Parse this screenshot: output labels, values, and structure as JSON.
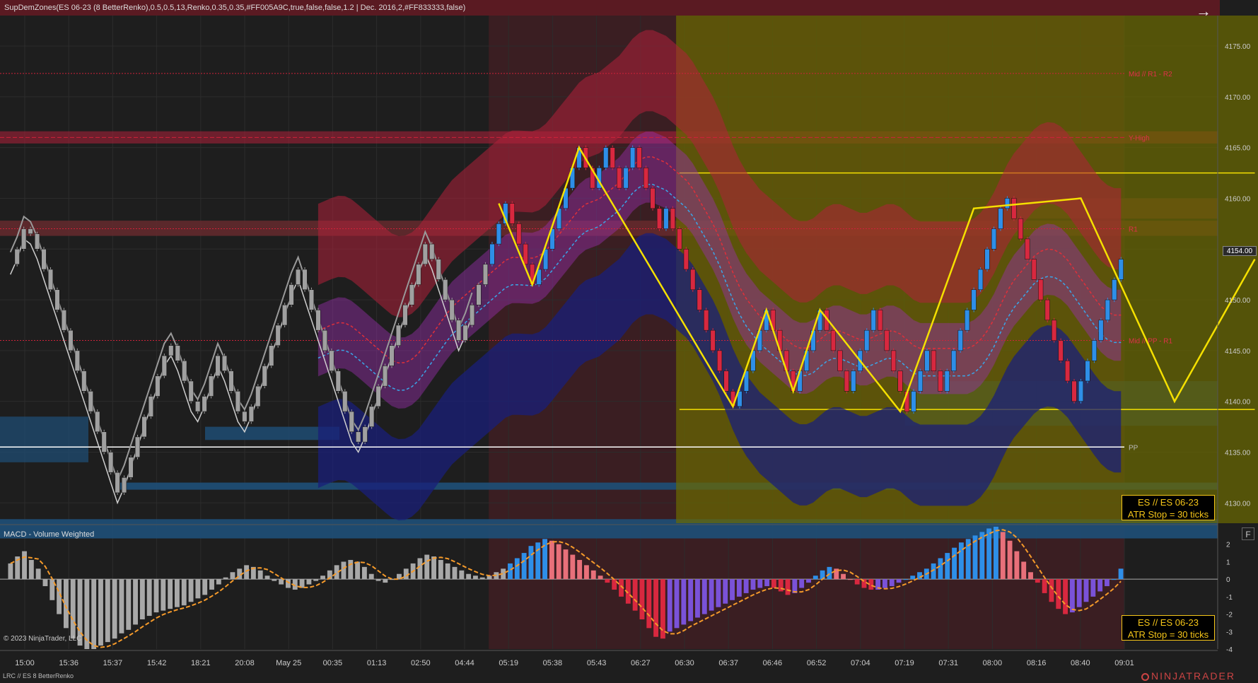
{
  "window": {
    "title": "SupDemZones(ES 06-23 (8 BetterRenko),0.5,0.5,13,Renko,0.35,0.35,#FF005A9C,true,false,false,1.2 | Dec. 2016,2,#FF833333,false)",
    "arrow_icon": "arrow-right-icon",
    "f_button_label": "F",
    "macd_title": "MACD - Volume Weighted",
    "copyright": "© 2023 NinjaTrader, LLC",
    "instrument_label": "LRC // ES  8 BetterRenko",
    "brand": "NINJATRADER",
    "current_price": "4154.00"
  },
  "info_boxes": [
    {
      "line1": "ES // ES 06-23",
      "line2": "ATR Stop = 30 ticks"
    },
    {
      "line1": "ES // ES 06-23",
      "line2": "ATR Stop = 30 ticks"
    }
  ],
  "colors": {
    "background": "#1e1e1e",
    "up_candle": "#2e8fe8",
    "down_candle": "#d8283f",
    "neutral_candle": "#a0a0a0",
    "red_band": "#b0203a",
    "blue_band": "#1a1f7a",
    "magenta_band": "#9a2fae",
    "yellow_box": "#6b6a00",
    "session_shade": "#3d1e22",
    "zone_blue": "#1e4f78",
    "zone_red": "#6a2a2e",
    "trendline": "#f5e000",
    "accent_yellow": "#f5c518"
  },
  "chart_data": [
    {
      "type": "candlestick",
      "ylim": [
        4128,
        4178
      ],
      "y_ticks": [
        4130,
        4135,
        4140,
        4145,
        4150,
        4155,
        4160,
        4165,
        4170,
        4175
      ],
      "x_tick_labels": [
        "15:00",
        "15:36",
        "15:37",
        "15:42",
        "18:21",
        "20:08",
        "May 25",
        "00:35",
        "01:13",
        "02:50",
        "04:44",
        "05:19",
        "05:38",
        "05:43",
        "06:27",
        "06:30",
        "06:37",
        "06:46",
        "06:52",
        "07:04",
        "07:19",
        "07:31",
        "08:00",
        "08:16",
        "08:40",
        "09:01"
      ],
      "levels": [
        {
          "name": "Mid // R1 - R2",
          "value": 4172.3
        },
        {
          "name": "Y-High",
          "value": 4166.0
        },
        {
          "name": "R1",
          "value": 4157.0
        },
        {
          "name": "Mid // PP - R1",
          "value": 4146.0
        },
        {
          "name": "PP",
          "value": 4135.5
        }
      ],
      "box": {
        "from_bar": 100,
        "to_bar": 186,
        "high": 4162.5,
        "low": 4139.2
      },
      "closes": [
        4153.5,
        4155.0,
        4157.0,
        4156.5,
        4155.0,
        4153.0,
        4151.0,
        4149.0,
        4147.0,
        4145.0,
        4143.0,
        4141.0,
        4139.0,
        4137.0,
        4135.0,
        4133.0,
        4131.0,
        4132.5,
        4134.5,
        4136.5,
        4138.5,
        4140.5,
        4142.5,
        4144.5,
        4145.5,
        4144.0,
        4142.0,
        4140.0,
        4139.0,
        4140.5,
        4142.5,
        4144.5,
        4143.0,
        4141.0,
        4139.0,
        4138.0,
        4139.5,
        4141.5,
        4143.5,
        4145.5,
        4147.5,
        4149.5,
        4151.5,
        4153.0,
        4151.0,
        4149.0,
        4147.0,
        4145.0,
        4143.0,
        4141.0,
        4139.0,
        4137.0,
        4136.0,
        4137.5,
        4139.5,
        4141.5,
        4143.5,
        4145.5,
        4147.5,
        4149.5,
        4151.5,
        4153.5,
        4155.5,
        4154.0,
        4152.0,
        4150.0,
        4148.0,
        4146.0,
        4147.5,
        4149.5,
        4151.5,
        4153.5,
        4155.5,
        4157.5,
        4159.5,
        4157.5,
        4155.5,
        4153.5,
        4151.5,
        4153.0,
        4155.0,
        4157.0,
        4159.0,
        4161.0,
        4163.0,
        4165.0,
        4163.0,
        4161.0,
        4163.0,
        4165.0,
        4163.0,
        4161.0,
        4163.0,
        4165.0,
        4163.0,
        4161.0,
        4159.0,
        4157.0,
        4159.0,
        4157.0,
        4155.0,
        4153.0,
        4151.0,
        4149.0,
        4147.0,
        4145.0,
        4143.0,
        4141.0,
        4139.5,
        4141.0,
        4143.0,
        4145.0,
        4147.0,
        4149.0,
        4147.0,
        4145.0,
        4143.0,
        4141.0,
        4143.0,
        4145.0,
        4147.0,
        4149.0,
        4147.0,
        4145.0,
        4143.0,
        4141.0,
        4143.0,
        4145.0,
        4147.0,
        4149.0,
        4147.0,
        4145.0,
        4143.0,
        4141.0,
        4139.0,
        4141.0,
        4143.0,
        4145.0,
        4143.0,
        4141.0,
        4143.0,
        4145.0,
        4147.0,
        4149.0,
        4151.0,
        4153.0,
        4155.0,
        4157.0,
        4159.0,
        4160.0,
        4158.0,
        4156.0,
        4154.0,
        4152.0,
        4150.0,
        4148.0,
        4146.0,
        4144.0,
        4142.0,
        4140.0,
        4142.0,
        4144.0,
        4146.0,
        4148.0,
        4150.0,
        4152.0,
        4154.0
      ]
    },
    {
      "type": "bar",
      "title": "MACD - Volume Weighted",
      "ylim": [
        -4,
        3
      ],
      "y_ticks": [
        2,
        1,
        0,
        -1,
        -2,
        -3,
        -4
      ],
      "values": [
        0.9,
        1.3,
        1.6,
        1.1,
        0.6,
        -0.4,
        -1.2,
        -2.0,
        -2.8,
        -3.4,
        -3.8,
        -4.0,
        -4.0,
        -3.8,
        -3.6,
        -3.4,
        -3.1,
        -2.9,
        -2.6,
        -2.3,
        -2.1,
        -1.9,
        -1.8,
        -1.7,
        -1.6,
        -1.5,
        -1.3,
        -1.1,
        -0.9,
        -0.6,
        -0.3,
        0.1,
        0.4,
        0.6,
        0.8,
        0.7,
        0.5,
        0.2,
        -0.1,
        -0.3,
        -0.5,
        -0.6,
        -0.5,
        -0.3,
        -0.1,
        0.2,
        0.5,
        0.8,
        1.0,
        1.1,
        1.0,
        0.7,
        0.3,
        -0.1,
        -0.2,
        0.0,
        0.3,
        0.6,
        0.9,
        1.2,
        1.4,
        1.3,
        1.1,
        0.9,
        0.7,
        0.5,
        0.3,
        0.2,
        0.1,
        0.2,
        0.4,
        0.6,
        0.9,
        1.2,
        1.5,
        1.9,
        2.1,
        2.3,
        2.2,
        2.0,
        1.7,
        1.4,
        1.1,
        0.8,
        0.5,
        0.2,
        -0.2,
        -0.6,
        -1.0,
        -1.4,
        -1.8,
        -2.3,
        -2.8,
        -3.3,
        -3.4,
        -3.0,
        -2.8,
        -2.6,
        -2.4,
        -2.2,
        -2.0,
        -1.8,
        -1.6,
        -1.4,
        -1.2,
        -1.0,
        -0.8,
        -0.6,
        -0.5,
        -0.4,
        -0.5,
        -0.7,
        -0.9,
        -0.8,
        -0.5,
        -0.2,
        0.2,
        0.5,
        0.7,
        0.6,
        0.3,
        0.0,
        -0.3,
        -0.5,
        -0.6,
        -0.6,
        -0.5,
        -0.4,
        -0.2,
        0.0,
        0.2,
        0.4,
        0.6,
        0.9,
        1.2,
        1.5,
        1.8,
        2.1,
        2.3,
        2.5,
        2.7,
        2.9,
        3.0,
        2.7,
        2.2,
        1.6,
        1.0,
        0.4,
        -0.2,
        -0.8,
        -1.3,
        -1.7,
        -2.0,
        -1.9,
        -1.6,
        -1.3,
        -1.0,
        -0.7,
        -0.4,
        0.0,
        0.6
      ]
    }
  ]
}
